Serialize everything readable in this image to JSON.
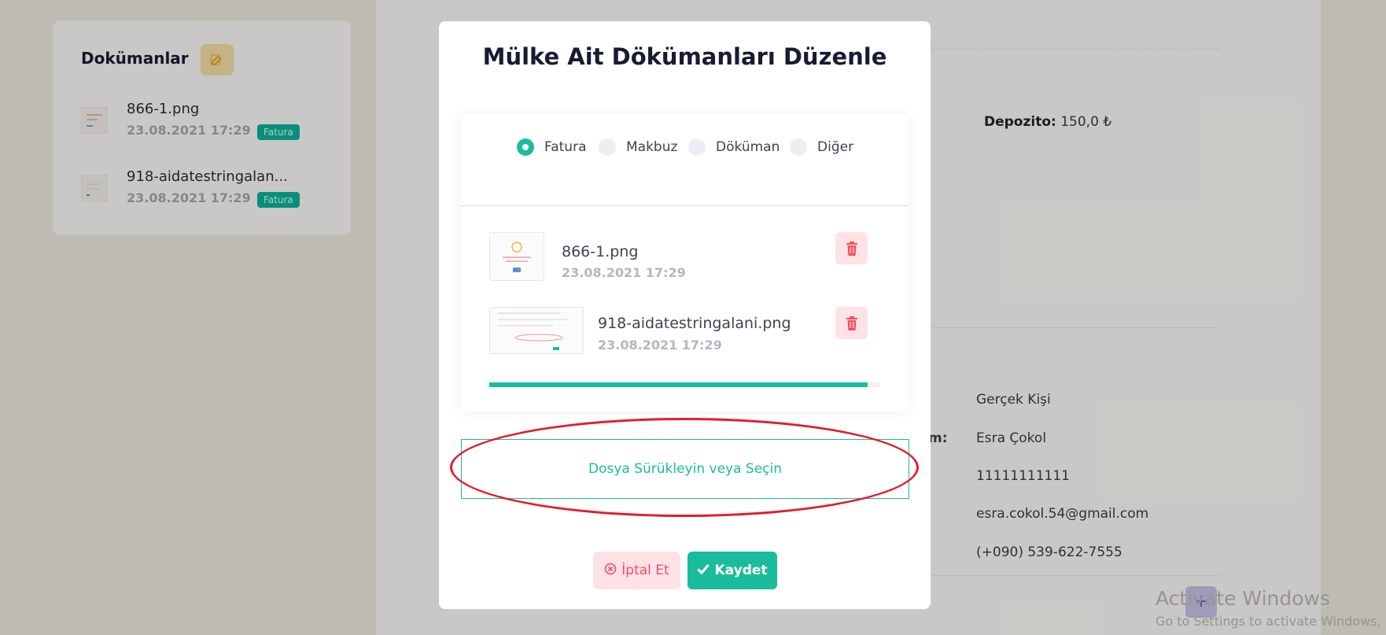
{
  "background": {
    "documents_panel": {
      "title": "Dokümanlar",
      "items": [
        {
          "name": "866-1.png",
          "date": "23.08.2021 17:29",
          "badge": "Fatura"
        },
        {
          "name": "918-aidatestringalan...",
          "date": "23.08.2021 17:29",
          "badge": "Fatura"
        }
      ]
    },
    "deposit": {
      "label": "Depozito:",
      "value": "150,0 ₺"
    },
    "partial_label": "m:",
    "owner_info": {
      "type": "Gerçek Kişi",
      "name": "Esra Çokol",
      "id_number": "11111111111",
      "email": "esra.cokol.54@gmail.com",
      "phone": "(+090) 539-622-7555"
    },
    "watermark": {
      "line1": "Activate Windows",
      "line2": "Go to Settings to activate Windows."
    }
  },
  "modal": {
    "title": "Mülke Ait Dökümanları Düzenle",
    "radio_options": [
      {
        "label": "Fatura",
        "checked": true
      },
      {
        "label": "Makbuz",
        "checked": false
      },
      {
        "label": "Döküman",
        "checked": false
      },
      {
        "label": "Diğer",
        "checked": false
      }
    ],
    "files": [
      {
        "name": "866-1.png",
        "date": "23.08.2021 17:29"
      },
      {
        "name": "918-aidatestringalani.png",
        "date": "23.08.2021 17:29"
      }
    ],
    "upload_progress": 0.97,
    "dropzone_text": "Dosya Sürükleyin veya Seçin",
    "cancel_label": "İptal Et",
    "save_label": "Kaydet"
  },
  "colors": {
    "accent": "#1bbc9b",
    "danger": "#f64e60",
    "annotation": "#e01e2b"
  }
}
